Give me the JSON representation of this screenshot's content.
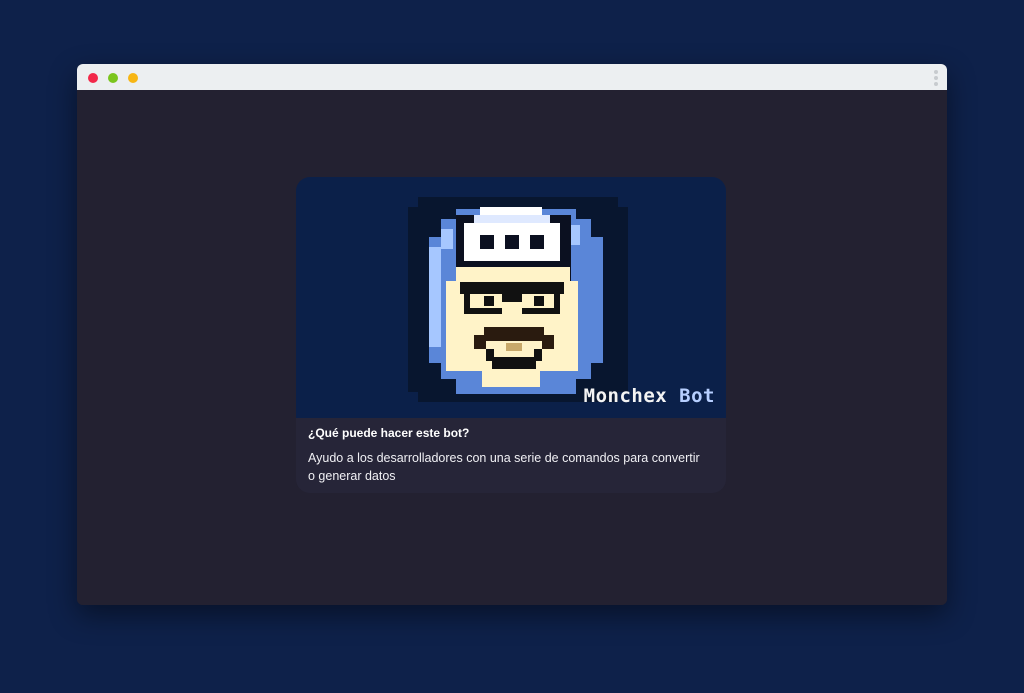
{
  "window": {
    "controls": [
      "close",
      "minimize",
      "maximize"
    ],
    "menu_icon": "kebab-menu-icon"
  },
  "bot_card": {
    "image": {
      "description_icon": "pixel-avatar-icon",
      "logo_text_part1": "Monchex",
      "logo_text_part2": "Bot"
    },
    "title": "¿Qué puede hacer este bot?",
    "description": "Ayudo a los desarrolladores con una serie de comandos para convertir o generar datos"
  },
  "colors": {
    "page_background": "#0e214a",
    "window_background": "#232131",
    "titlebar": "#eceff1",
    "card_background": "#262538",
    "image_background": "#0b2049",
    "close_dot": "#f2284a",
    "minimize_dot": "#7bc51e",
    "maximize_dot": "#f7b615"
  }
}
